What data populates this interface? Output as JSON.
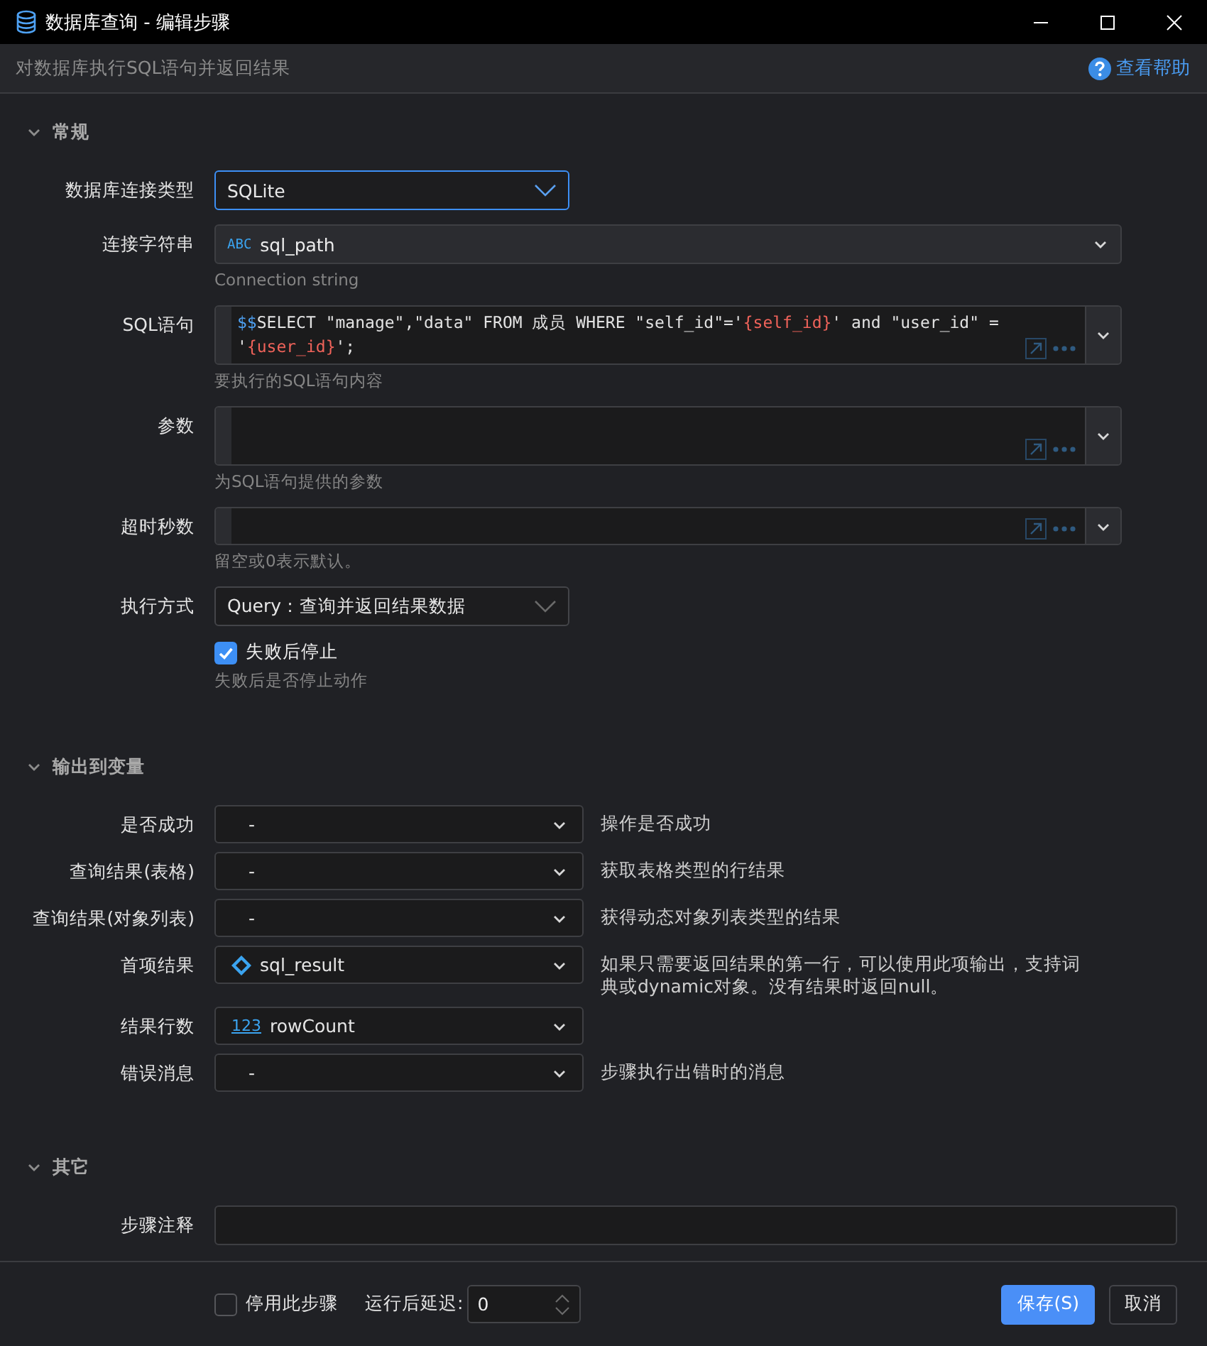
{
  "window": {
    "title": "数据库查询 - 编辑步骤"
  },
  "header": {
    "description": "对数据库执行SQL语句并返回结果",
    "help_link": "查看帮助"
  },
  "sections": [
    {
      "title": "常规",
      "expanded": true,
      "fields": [
        {
          "kind": "select",
          "label": "数据库连接类型",
          "value": "SQLite",
          "focused": true
        },
        {
          "kind": "variable",
          "label": "连接字符串",
          "variable": {
            "kind": "string",
            "badge": "ABC",
            "name": "sql_path"
          },
          "hint": "Connection string"
        },
        {
          "kind": "code",
          "label": "SQL语句",
          "multiline": true,
          "segments": [
            {
              "kind": "prefix",
              "text": "$$"
            },
            {
              "kind": "plain",
              "text": "SELECT \"manage\",\"data\" FROM 成员 WHERE \"self_id\"='"
            },
            {
              "kind": "variable",
              "text": "{self_id}"
            },
            {
              "kind": "plain",
              "text": "' and \"user_id\" = '"
            },
            {
              "kind": "variable",
              "text": "{user_id}"
            },
            {
              "kind": "plain",
              "text": "';"
            }
          ],
          "hint": "要执行的SQL语句内容"
        },
        {
          "kind": "code",
          "label": "参数",
          "multiline": true,
          "hint": "为SQL语句提供的参数"
        },
        {
          "kind": "code",
          "label": "超时秒数",
          "multiline": false,
          "hint": "留空或0表示默认。"
        },
        {
          "kind": "select",
          "label": "执行方式",
          "value": "Query：查询并返回结果数据",
          "focused": false
        },
        {
          "kind": "checkbox",
          "label": "失败后停止",
          "checked": true,
          "hint": "失败后是否停止动作"
        }
      ]
    },
    {
      "title": "输出到变量",
      "expanded": true,
      "fields": [
        {
          "kind": "output",
          "label": "是否成功",
          "value": "-",
          "description": "操作是否成功"
        },
        {
          "kind": "output",
          "label": "查询结果(表格)",
          "value": "-",
          "description": "获取表格类型的行结果"
        },
        {
          "kind": "output",
          "label": "查询结果(对象列表)",
          "value": "-",
          "description": "获得动态对象列表类型的结果"
        },
        {
          "kind": "output",
          "label": "首项结果",
          "variable": {
            "kind": "object",
            "name": "sql_result"
          },
          "description": "如果只需要返回结果的第一行，可以使用此项输出，支持词典或dynamic对象。没有结果时返回null。"
        },
        {
          "kind": "output",
          "label": "结果行数",
          "variable": {
            "kind": "number",
            "badge": "123",
            "name": "rowCount"
          }
        },
        {
          "kind": "output",
          "label": "错误消息",
          "value": "-",
          "description": "步骤执行出错时的消息"
        }
      ]
    },
    {
      "title": "其它",
      "expanded": true,
      "fields": [
        {
          "kind": "text",
          "label": "步骤注释"
        }
      ]
    }
  ],
  "footer": {
    "disable_step": {
      "label": "停用此步骤",
      "checked": false
    },
    "delay": {
      "label": "运行后延迟:",
      "value": "0"
    },
    "buttons": [
      {
        "label": "保存(S)",
        "kind": "primary"
      },
      {
        "label": "取消",
        "kind": "secondary"
      }
    ]
  }
}
